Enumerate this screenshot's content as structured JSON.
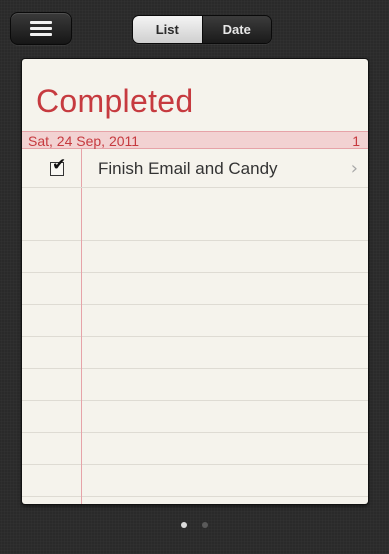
{
  "toolbar": {
    "menu_icon": "list-icon",
    "tabs": [
      {
        "label": "List",
        "selected": true
      },
      {
        "label": "Date",
        "selected": false
      }
    ]
  },
  "list": {
    "title": "Completed",
    "section": {
      "date": "Sat, 24 Sep, 2011",
      "count": "1"
    },
    "items": [
      {
        "label": "Finish Email and Candy",
        "completed": true
      }
    ]
  },
  "pager": {
    "pages": 2,
    "current": 1
  },
  "colors": {
    "accent_red": "#c63a3f",
    "paper": "#f5f3ec",
    "band": "#f2d2d2",
    "background": "#2a2a2a"
  }
}
